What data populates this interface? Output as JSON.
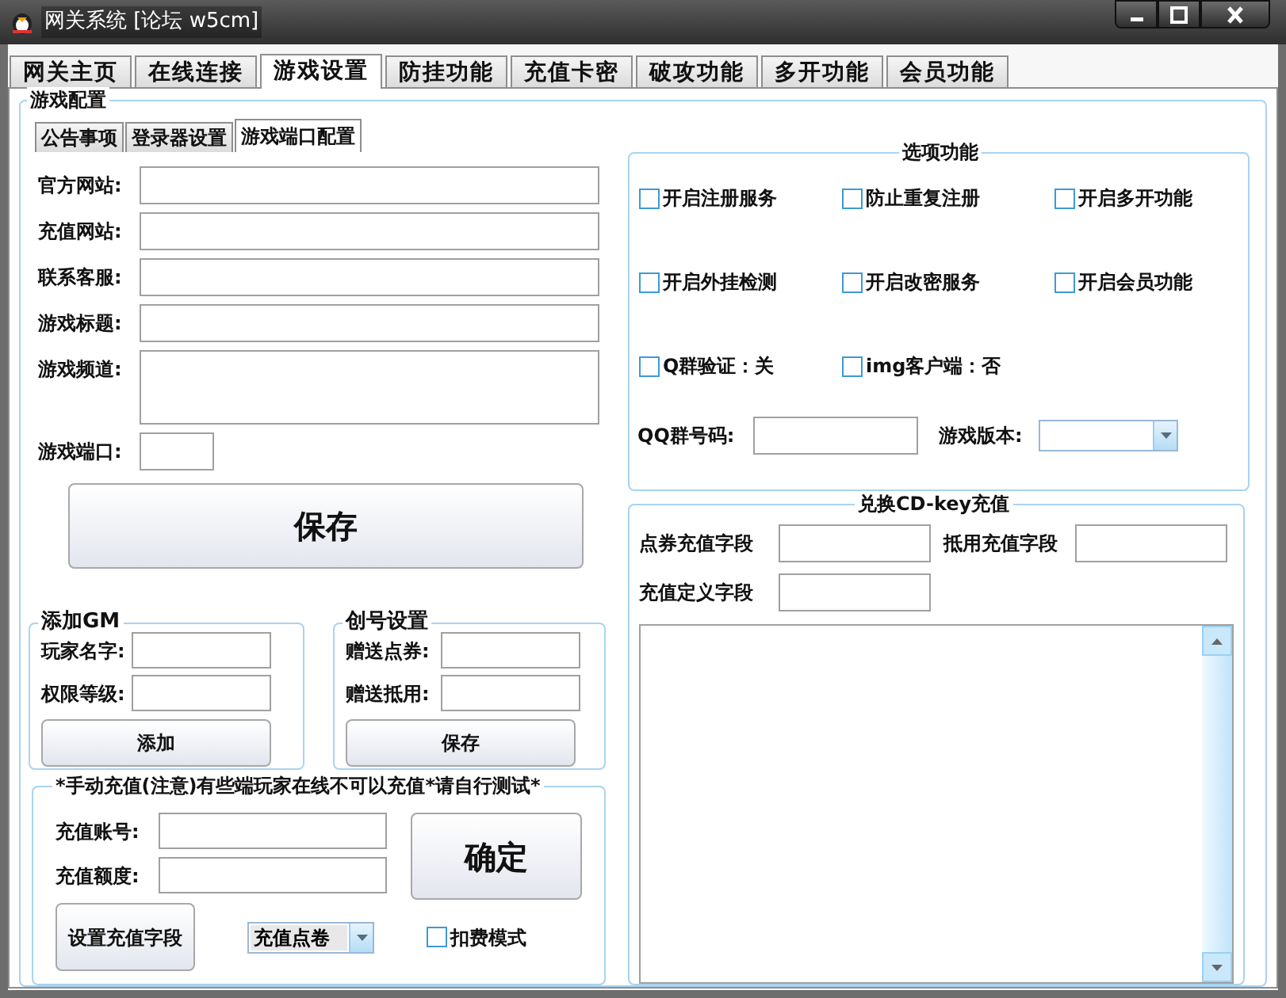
{
  "window": {
    "title": "网关系统 [论坛 w5cm]"
  },
  "tabs": [
    {
      "label": "网关主页",
      "selected": false
    },
    {
      "label": "在线连接",
      "selected": false
    },
    {
      "label": "游戏设置",
      "selected": true
    },
    {
      "label": "防挂功能",
      "selected": false
    },
    {
      "label": "充值卡密",
      "selected": false
    },
    {
      "label": "破攻功能",
      "selected": false
    },
    {
      "label": "多开功能",
      "selected": false
    },
    {
      "label": "会员功能",
      "selected": false
    }
  ],
  "config_group": {
    "title": "游戏配置",
    "sub_tabs": [
      {
        "label": "公告事项",
        "selected": false
      },
      {
        "label": "登录器设置",
        "selected": false
      },
      {
        "label": "游戏端口配置",
        "selected": true
      }
    ],
    "fields": [
      {
        "label": "官方网站:",
        "kind": "text"
      },
      {
        "label": "充值网站:",
        "kind": "text"
      },
      {
        "label": "联系客服:",
        "kind": "text"
      },
      {
        "label": "游戏标题:",
        "kind": "text"
      },
      {
        "label": "游戏频道:",
        "kind": "multiline"
      },
      {
        "label": "游戏端口:",
        "kind": "short"
      }
    ],
    "save_button": "保存"
  },
  "add_gm": {
    "title": "添加GM",
    "fields": [
      {
        "label": "玩家名字:"
      },
      {
        "label": "权限等级:"
      }
    ],
    "button": "添加"
  },
  "account_setup": {
    "title": "创号设置",
    "fields": [
      {
        "label": "赠送点券:"
      },
      {
        "label": "赠送抵用:"
      }
    ],
    "button": "保存"
  },
  "manual_charge": {
    "title": "*手动充值(注意)有些端玩家在线不可以充值*请自行测试*",
    "fields": [
      {
        "label": "充值账号:"
      },
      {
        "label": "充值额度:"
      }
    ],
    "confirm_button": "确定",
    "set_field_button": "设置充值字段",
    "charge_type": {
      "value": "充值点卷"
    },
    "deduct_mode": {
      "label": "扣费模式",
      "checked": false
    }
  },
  "options": {
    "title": "选项功能",
    "checkboxes": [
      {
        "label": "开启注册服务",
        "checked": false
      },
      {
        "label": "防止重复注册",
        "checked": false
      },
      {
        "label": "开启多开功能",
        "checked": false
      },
      {
        "label": "开启外挂检测",
        "checked": false
      },
      {
        "label": "开启改密服务",
        "checked": false
      },
      {
        "label": "开启会员功能",
        "checked": false
      },
      {
        "label": "Q群验证：关",
        "checked": false
      },
      {
        "label": "img客户端：否",
        "checked": false
      }
    ],
    "qq_group": {
      "label": "QQ群号码:"
    },
    "game_version": {
      "label": "游戏版本:"
    }
  },
  "cdkey": {
    "title": "兑换CD-key充值",
    "fields": [
      {
        "label": "点券充值字段"
      },
      {
        "label": "抵用充值字段"
      },
      {
        "label": "充值定义字段"
      }
    ]
  }
}
